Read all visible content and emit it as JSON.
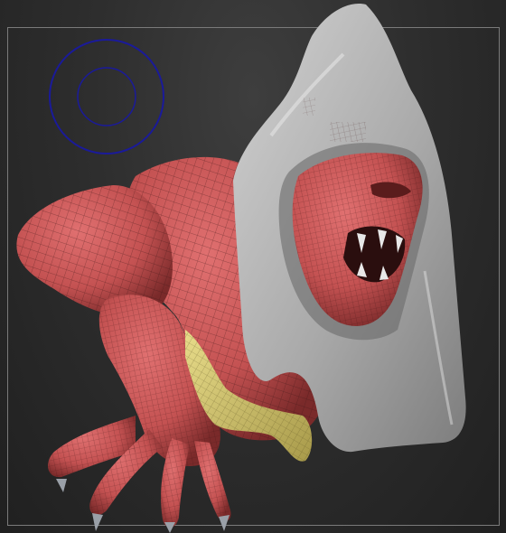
{
  "viewport": {
    "background_color": "#2c2c2c",
    "frame_color": "#7a7a7a",
    "brush_cursor_color": "#1a1a9a",
    "skin_color": "#c95757",
    "hood_color": "#b9b9b9",
    "cloth_color": "#d9cc78",
    "wireframe_color": "#3a1414",
    "elements": [
      "brush-cursor",
      "document-frame",
      "creature-sculpt"
    ]
  }
}
